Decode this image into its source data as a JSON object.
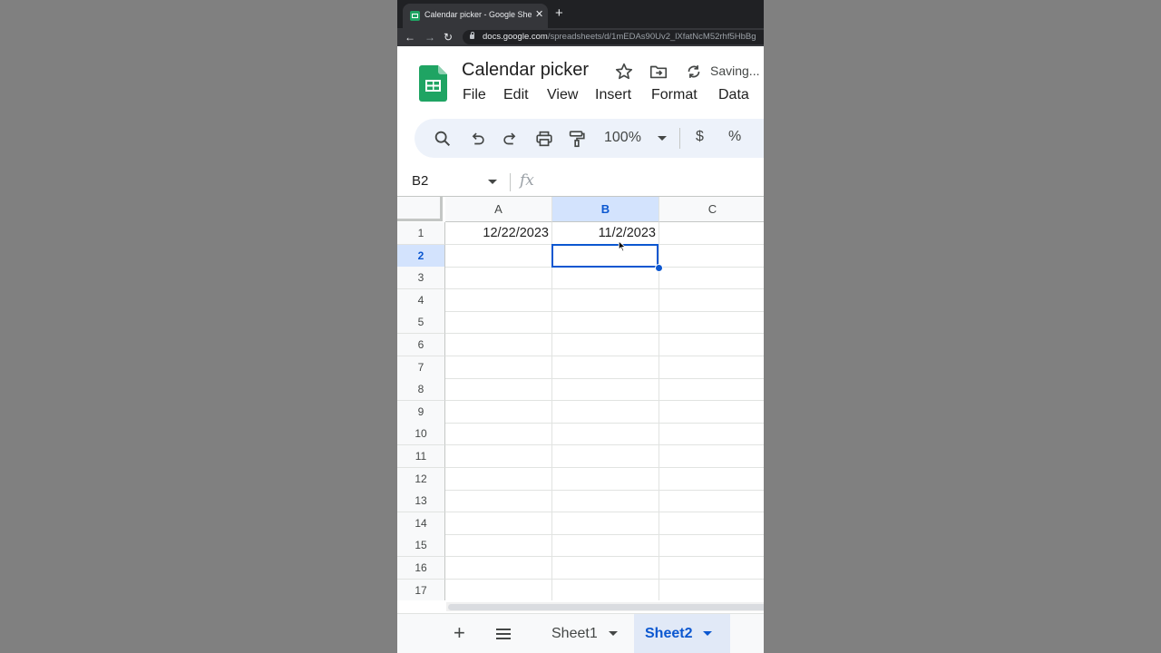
{
  "browser": {
    "tab_title": "Calendar picker - Google Sheets",
    "tab_close": "✕",
    "new_tab": "+",
    "back": "←",
    "forward": "→",
    "reload": "↻",
    "url_host": "docs.google.com",
    "url_path": "/spreadsheets/d/1mEDAs90Uv2_lXfatNcM52rhf5HbBg"
  },
  "header": {
    "title": "Calendar picker",
    "status": "Saving..."
  },
  "menu": [
    "File",
    "Edit",
    "View",
    "Insert",
    "Format",
    "Data"
  ],
  "toolbar": {
    "zoom": "100%",
    "currency": "$",
    "percent": "%",
    "more": "⋮"
  },
  "formula_bar": {
    "name_box": "B2",
    "fx": "fx",
    "value": ""
  },
  "grid": {
    "columns": [
      "A",
      "B",
      "C"
    ],
    "selected_column": "B",
    "rows": [
      "1",
      "2",
      "3",
      "4",
      "5",
      "6",
      "7",
      "8",
      "9",
      "10",
      "11",
      "12",
      "13",
      "14",
      "15",
      "16",
      "17"
    ],
    "selected_row": "2",
    "cells": {
      "A1": "12/22/2023",
      "B1": "11/2/2023"
    },
    "active_cell": "B2"
  },
  "sheets": {
    "add": "+",
    "tabs": [
      "Sheet1",
      "Sheet2"
    ],
    "active": "Sheet2"
  },
  "colors": {
    "accent": "#0b57d0",
    "selected_header_bg": "#d3e3fd",
    "toolbar_bg": "#edf2fa",
    "sheets_green": "#1fa463"
  },
  "icons": [
    "sheets-logo-icon",
    "star-icon",
    "move-to-folder-icon",
    "sync-icon",
    "search-icon",
    "undo-icon",
    "redo-icon",
    "print-icon",
    "paint-format-icon",
    "all-sheets-icon",
    "lock-icon",
    "mouse-cursor-icon"
  ]
}
